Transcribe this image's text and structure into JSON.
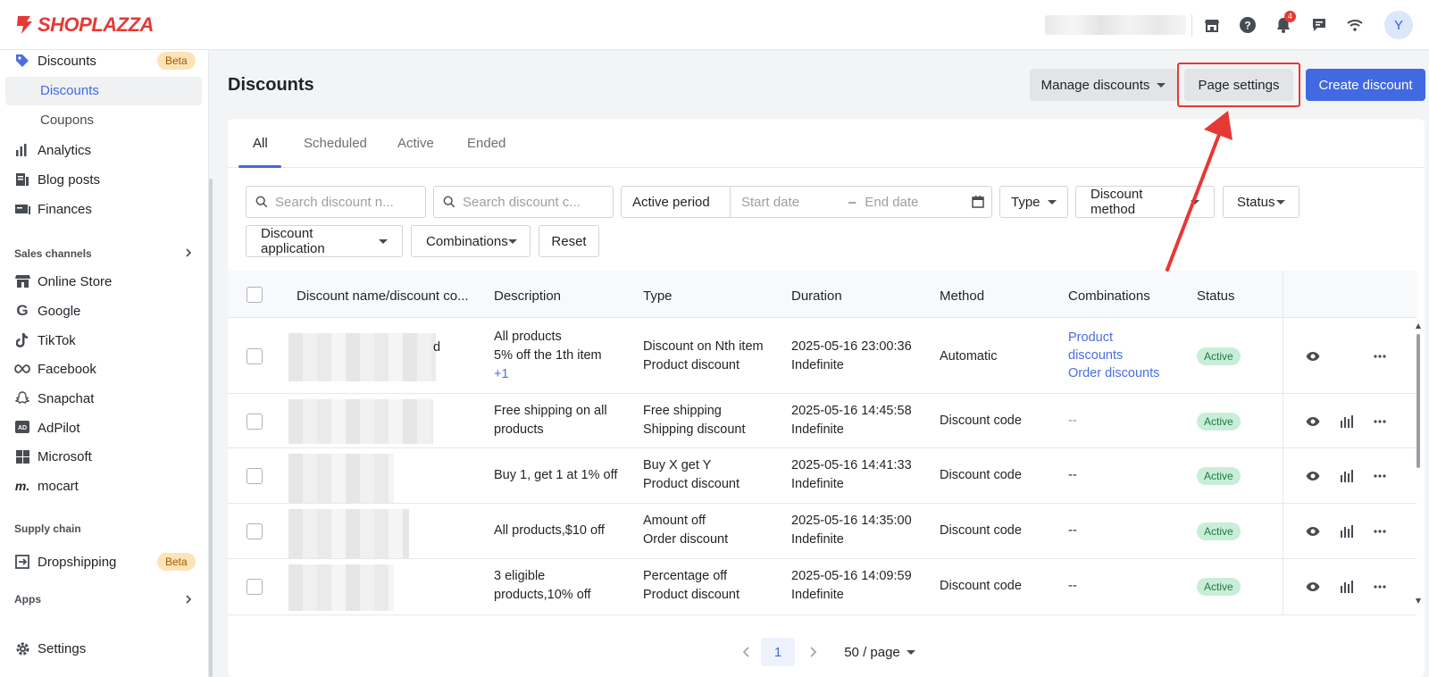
{
  "brand": {
    "name": "SHOPLAZZA",
    "color": "#e53935"
  },
  "topbar": {
    "notification_count": "4",
    "avatar_letter": "Y"
  },
  "sidebar": {
    "discounts": {
      "label": "Discounts",
      "badge": "Beta"
    },
    "sub_items": [
      {
        "label": "Discounts"
      },
      {
        "label": "Coupons"
      }
    ],
    "items": [
      {
        "label": "Analytics"
      },
      {
        "label": "Blog posts"
      },
      {
        "label": "Finances"
      }
    ],
    "sales_channels_label": "Sales channels",
    "channels": [
      {
        "label": "Online Store"
      },
      {
        "label": "Google"
      },
      {
        "label": "TikTok"
      },
      {
        "label": "Facebook"
      },
      {
        "label": "Snapchat"
      },
      {
        "label": "AdPilot"
      },
      {
        "label": "Microsoft"
      },
      {
        "label": "mocart"
      }
    ],
    "supply_chain_label": "Supply chain",
    "dropshipping": {
      "label": "Dropshipping",
      "badge": "Beta"
    },
    "apps_label": "Apps",
    "settings_label": "Settings"
  },
  "header": {
    "title": "Discounts",
    "manage_label": "Manage discounts",
    "page_settings_label": "Page settings",
    "create_label": "Create discount",
    "primary_color": "#4169e1",
    "highlight_color": "#e53935"
  },
  "tabs": [
    {
      "label": "All"
    },
    {
      "label": "Scheduled"
    },
    {
      "label": "Active"
    },
    {
      "label": "Ended"
    }
  ],
  "filters": {
    "search_name_placeholder": "Search discount n...",
    "search_code_placeholder": "Search discount c...",
    "active_period_label": "Active period",
    "start_placeholder": "Start date",
    "end_placeholder": "End date",
    "type_label": "Type",
    "method_label": "Discount method",
    "status_label": "Status",
    "application_label": "Discount application",
    "combinations_label": "Combinations",
    "reset_label": "Reset"
  },
  "table": {
    "headers": {
      "name": "Discount name/discount co...",
      "description": "Description",
      "type": "Type",
      "duration": "Duration",
      "method": "Method",
      "combinations": "Combinations",
      "status": "Status"
    },
    "rows": [
      {
        "name_tail": "d",
        "description": [
          "All products",
          "5% off the 1th item"
        ],
        "description_more": "+1",
        "type": [
          "Discount on Nth item",
          "Product discount"
        ],
        "duration": [
          "2025-05-16 23:00:36",
          "Indefinite"
        ],
        "method": "Automatic",
        "combinations": [
          "Product",
          "discounts",
          "Order discounts"
        ],
        "status": "Active"
      },
      {
        "description": [
          "Free shipping on all",
          "products"
        ],
        "type": [
          "Free shipping",
          "Shipping discount"
        ],
        "duration": [
          "2025-05-16 14:45:58",
          "Indefinite"
        ],
        "method": "Discount code",
        "combinations_text": "--",
        "status": "Active"
      },
      {
        "description": [
          "Buy 1, get 1 at 1% off"
        ],
        "type": [
          "Buy X get Y",
          "Product discount"
        ],
        "duration": [
          "2025-05-16 14:41:33",
          "Indefinite"
        ],
        "method": "Discount code",
        "combinations_text": "--",
        "status": "Active"
      },
      {
        "description": [
          "All products,$10 off"
        ],
        "type": [
          "Amount off",
          "Order discount"
        ],
        "duration": [
          "2025-05-16 14:35:00",
          "Indefinite"
        ],
        "method": "Discount code",
        "combinations_text": "--",
        "status": "Active"
      },
      {
        "description": [
          "3 eligible",
          "products,10% off"
        ],
        "type": [
          "Percentage off",
          "Product discount"
        ],
        "duration": [
          "2025-05-16 14:09:59",
          "Indefinite"
        ],
        "method": "Discount code",
        "combinations_text": "--",
        "status": "Active"
      }
    ]
  },
  "pagination": {
    "current_page": "1",
    "page_size_label": "50 / page"
  }
}
